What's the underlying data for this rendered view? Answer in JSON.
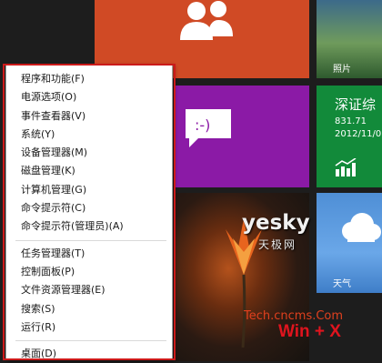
{
  "tiles": {
    "photos_label": "照片",
    "finance": {
      "title": "深证综",
      "value": "831.71",
      "date": "2012/11/0"
    },
    "weather_label": "天气"
  },
  "menu": {
    "group1": [
      "程序和功能(F)",
      "电源选项(O)",
      "事件查看器(V)",
      "系统(Y)",
      "设备管理器(M)",
      "磁盘管理(K)",
      "计算机管理(G)",
      "命令提示符(C)",
      "命令提示符(管理员)(A)"
    ],
    "group2": [
      "任务管理器(T)",
      "控制面板(P)",
      "文件资源管理器(E)",
      "搜索(S)",
      "运行(R)"
    ],
    "group3": [
      "桌面(D)"
    ]
  },
  "watermark": {
    "logo": "yesky",
    "logo_cn": "天极网",
    "site": "Tech.cncms.Com"
  },
  "shortcut_label": "Win + X",
  "colors": {
    "people_tile": "#d04a25",
    "messaging_tile": "#8b1aa6",
    "finance_tile": "#128a3a",
    "highlight_frame": "#cc1a1a",
    "shortcut_text": "#e0141e"
  }
}
